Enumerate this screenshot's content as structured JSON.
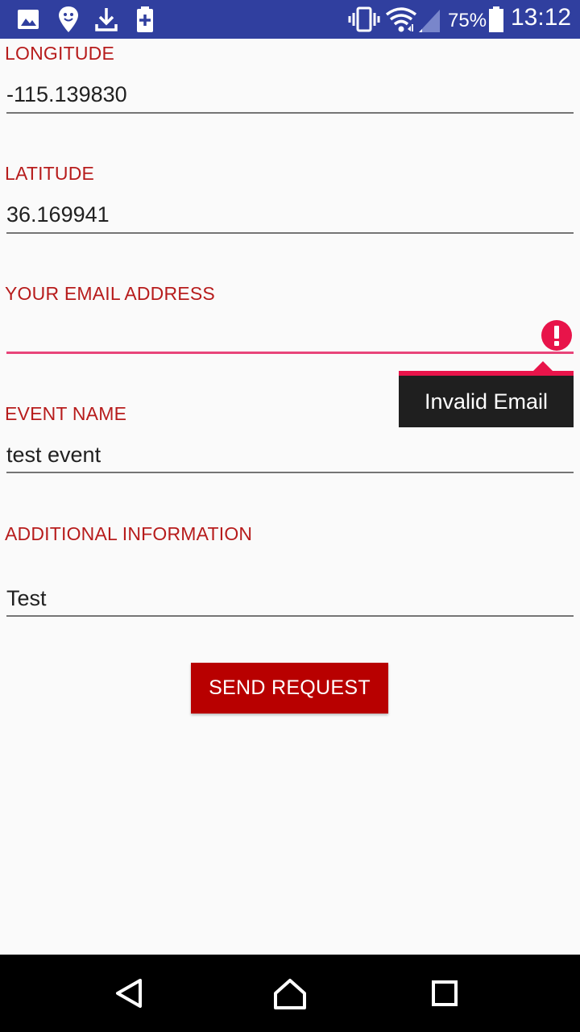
{
  "status_bar": {
    "battery_percent": "75%",
    "time": "13:12",
    "icons": [
      "image-icon",
      "location-icon",
      "download-icon",
      "battery-saver-icon",
      "vibrate-icon",
      "wifi-icon",
      "signal-icon",
      "battery-icon"
    ]
  },
  "form": {
    "longitude": {
      "label": "LONGITUDE",
      "value": "-115.139830"
    },
    "latitude": {
      "label": "LATITUDE",
      "value": "36.169941"
    },
    "email": {
      "label": "YOUR EMAIL ADDRESS",
      "value": "",
      "error": "Invalid Email"
    },
    "event_name": {
      "label": "EVENT NAME",
      "value": "test event"
    },
    "additional_info": {
      "label": "ADDITIONAL INFORMATION",
      "value": "Test"
    },
    "submit_label": "SEND REQUEST"
  },
  "colors": {
    "status_bar": "#303f9f",
    "label": "#b71c1c",
    "button": "#b80000",
    "error": "#e8144a"
  },
  "nav_bar": {
    "buttons": [
      "back-icon",
      "home-icon",
      "recents-icon"
    ]
  }
}
